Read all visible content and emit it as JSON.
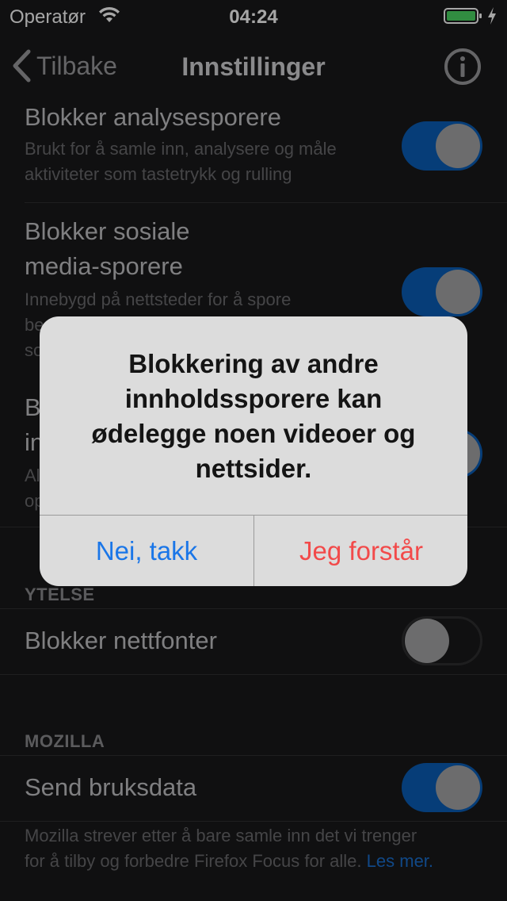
{
  "status_bar": {
    "operator": "Operatør",
    "time": "04:24"
  },
  "nav": {
    "back_label": "Tilbake",
    "title": "Innstillinger"
  },
  "rows": [
    {
      "title": "Blokker analysesporere",
      "description_lines": [
        "Brukt for å samle inn, analysere og måle",
        "aktiviteter som tastetrykk og rulling"
      ],
      "toggle": "on"
    },
    {
      "title_lines": [
        "Blokker sosiale",
        "media-sporere"
      ],
      "description_lines": [
        "Innebygd på nettsteder for å spore",
        "be",
        "so"
      ],
      "toggle": "on"
    },
    {
      "title_lines": [
        "B",
        "in"
      ],
      "description_lines": [
        "Al",
        "op"
      ],
      "toggle": "on"
    }
  ],
  "section_performance": {
    "header": "YTELSE",
    "row_title": "Blokker nettfonter",
    "toggle": "off"
  },
  "section_mozilla": {
    "header": "MOZILLA",
    "row_title": "Send bruksdata",
    "toggle": "on",
    "footer_lines": [
      "Mozilla strever etter å bare samle inn det vi trenger",
      "for å tilby og forbedre Firefox Focus for alle."
    ],
    "learn_more": "Les mer."
  },
  "alert": {
    "message_lines": [
      "Blokkering av andre",
      "innholdssporere kan",
      "ødelegge noen videoer og",
      "nettsider."
    ],
    "cancel_label": "Nei, takk",
    "confirm_label": "Jeg forstår"
  },
  "colors": {
    "toggle_on": "#0a5fb9",
    "alert_cancel": "#1a76e8",
    "alert_confirm": "#f24a4a"
  }
}
